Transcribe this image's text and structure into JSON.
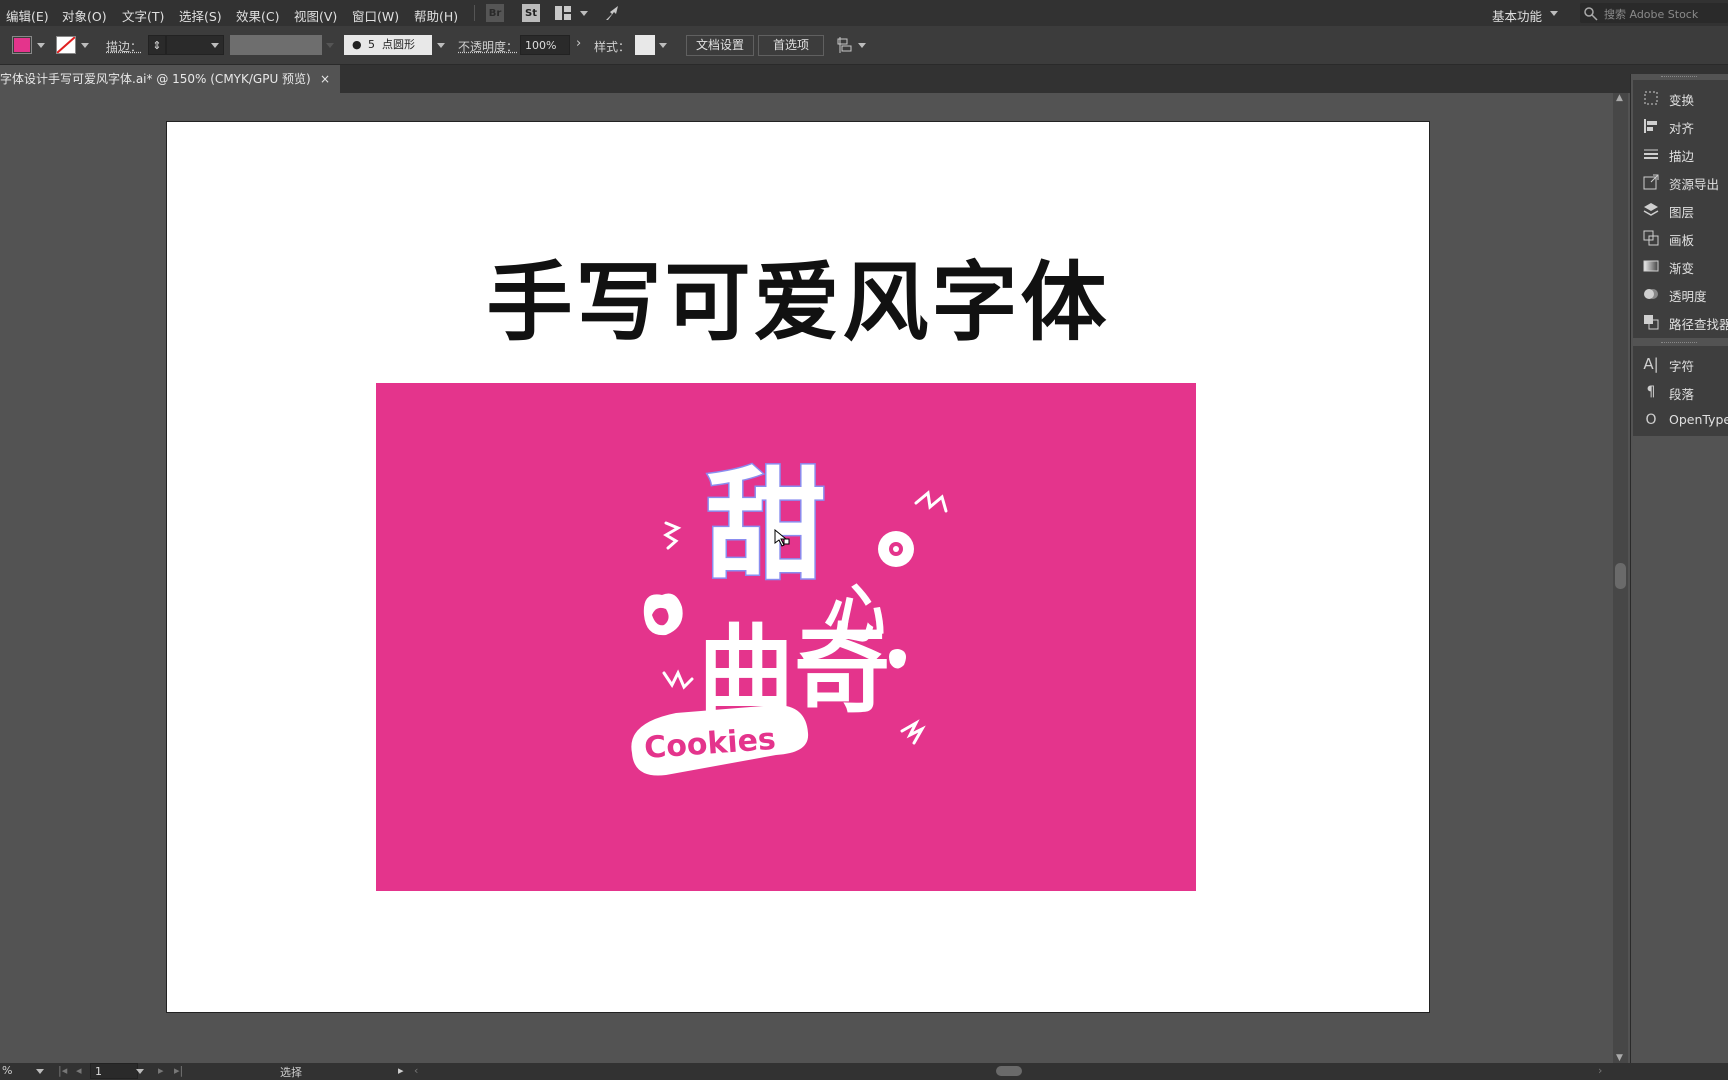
{
  "menubar": {
    "items": [
      "编辑(E)",
      "对象(O)",
      "文字(T)",
      "选择(S)",
      "效果(C)",
      "视图(V)",
      "窗口(W)",
      "帮助(H)"
    ],
    "workspace": "基本功能",
    "search_placeholder": "搜索 Adobe Stock"
  },
  "controlbar": {
    "stroke_label": "描边：",
    "brush_size": "5",
    "brush_type": "点圆形",
    "opacity_label": "不透明度：",
    "opacity_value": "100%",
    "style_label": "样式：",
    "doc_setup_button": "文档设置",
    "preferences_button": "首选项",
    "fill_color": "#e4348c"
  },
  "tab": {
    "title": "字体设计手写可爱风字体.ai* @ 150% (CMYK/GPU 预览)",
    "close": "×"
  },
  "artboard": {
    "heading": "手写可爱风字体",
    "background_color": "#e4348c",
    "artwork": {
      "lettering_top": "甜",
      "lettering_middle": "曲奇",
      "lettering_small": "心",
      "cookies_label": "Cookies"
    }
  },
  "panel": {
    "group1": [
      {
        "icon": "transform-icon",
        "label": "变换"
      },
      {
        "icon": "align-icon",
        "label": "对齐"
      },
      {
        "icon": "stroke-icon",
        "label": "描边"
      },
      {
        "icon": "asset-export-icon",
        "label": "资源导出"
      },
      {
        "icon": "layers-icon",
        "label": "图层"
      },
      {
        "icon": "artboards-icon",
        "label": "画板"
      },
      {
        "icon": "gradient-icon",
        "label": "渐变"
      },
      {
        "icon": "transparency-icon",
        "label": "透明度"
      },
      {
        "icon": "pathfinder-icon",
        "label": "路径查找器"
      }
    ],
    "group2": [
      {
        "icon": "character-icon",
        "label": "字符"
      },
      {
        "icon": "paragraph-icon",
        "label": "段落"
      },
      {
        "icon": "opentype-icon",
        "label": "OpenType"
      }
    ]
  },
  "statusbar": {
    "zoom": "%",
    "artboard_number": "1",
    "tool": "选择"
  }
}
